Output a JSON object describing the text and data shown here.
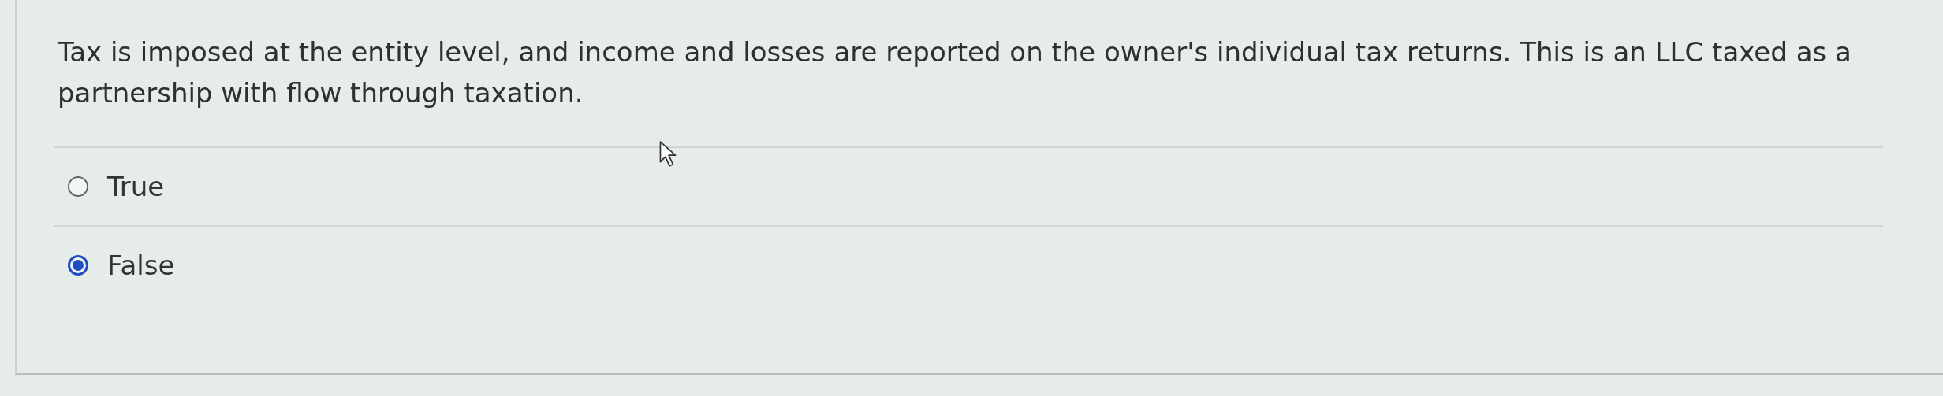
{
  "question": {
    "text": "Tax is imposed at the entity level, and income and losses are reported on the owner's individual tax returns. This is an LLC taxed as a partnership with flow through taxation."
  },
  "options": [
    {
      "label": "True",
      "selected": false
    },
    {
      "label": "False",
      "selected": true
    }
  ]
}
